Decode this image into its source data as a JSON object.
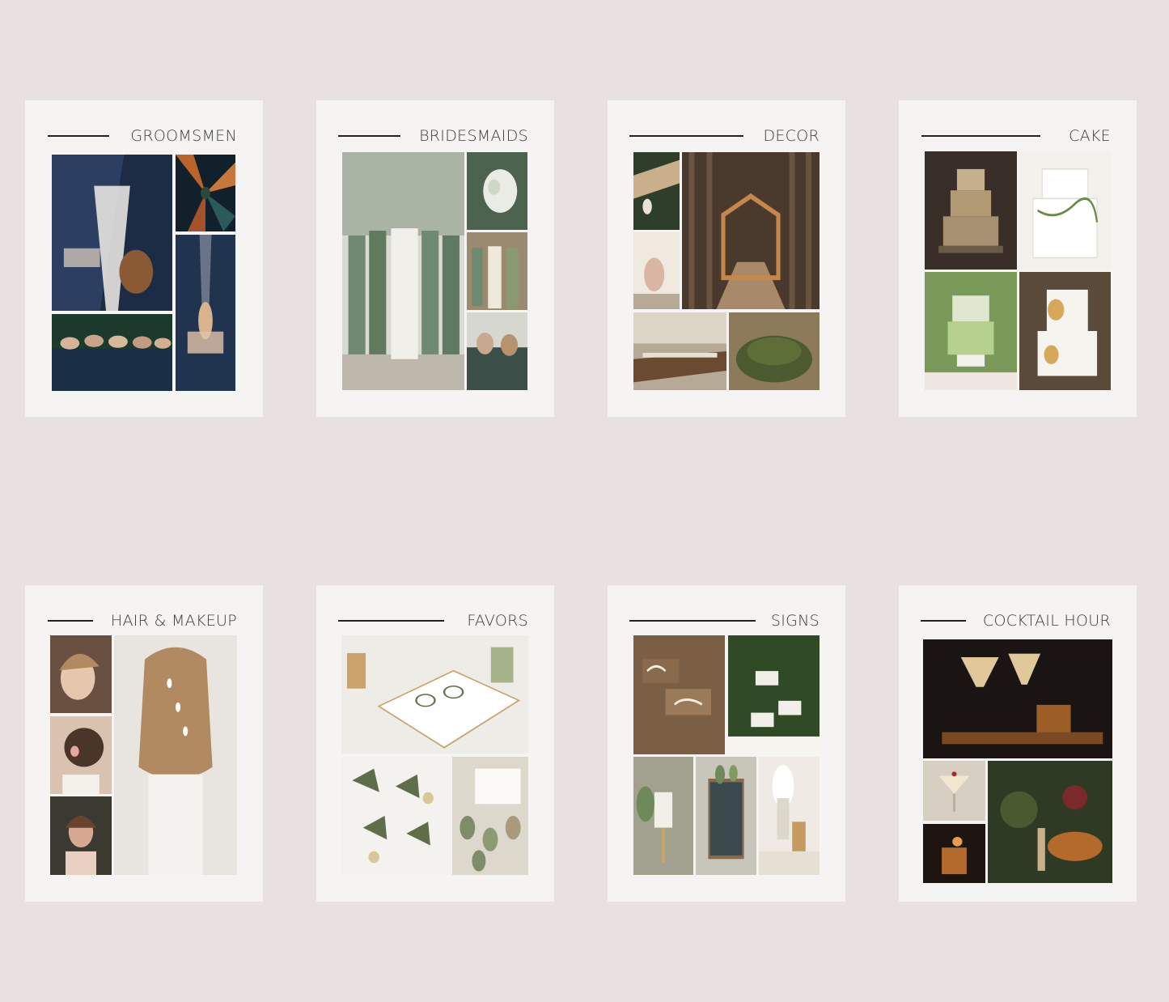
{
  "boards": [
    {
      "title": "GROOMSMEN",
      "colors": {
        "bg": "#1c2c44",
        "a": "#2c3f63",
        "b": "#8a5a34",
        "c": "#1b3a36",
        "d": "#20344f",
        "e": "#f2efe9"
      }
    },
    {
      "title": "BRIDESMAIDS",
      "colors": {
        "bg": "#d9dbd2",
        "a": "#6f8a70",
        "b": "#4c6350",
        "c": "#9a8a70",
        "d": "#3b4f48",
        "e": "#f1efe9"
      }
    },
    {
      "title": "DECOR",
      "colors": {
        "bg": "#4a3a2e",
        "a": "#2f3e2a",
        "b": "#6a5440",
        "c": "#b6aa96",
        "d": "#4c5a30",
        "e": "#efe9df"
      }
    },
    {
      "title": "CAKE",
      "colors": {
        "bg": "#3a2f28",
        "a": "#f3f1ec",
        "b": "#a69070",
        "c": "#8db06a",
        "d": "#5a4a3a",
        "e": "#ffffff"
      }
    },
    {
      "title": "HAIR & MAKEUP",
      "colors": {
        "bg": "#e8e4df",
        "a": "#b28a62",
        "b": "#6a5040",
        "c": "#d9c2b0",
        "d": "#3b3a30",
        "e": "#f4f2ef"
      }
    },
    {
      "title": "FAVORS",
      "colors": {
        "bg": "#eeece6",
        "a": "#c9a36a",
        "b": "#5e6e48",
        "c": "#dcd8cc",
        "d": "#7f8c6a",
        "e": "#ffffff"
      }
    },
    {
      "title": "SIGNS",
      "colors": {
        "bg": "#7a5f44",
        "a": "#2f4a24",
        "b": "#f1efe8",
        "c": "#3a4a4e",
        "d": "#a2a08e",
        "e": "#ffffff"
      }
    },
    {
      "title": "COCKTAIL HOUR",
      "colors": {
        "bg": "#1a1412",
        "a": "#e0c89a",
        "b": "#7a4a24",
        "c": "#2f3a24",
        "d": "#b46a2a",
        "e": "#f2e6cc"
      }
    }
  ]
}
